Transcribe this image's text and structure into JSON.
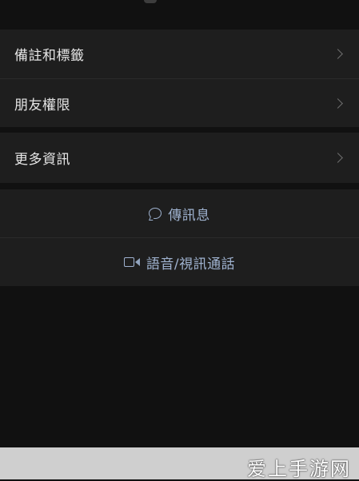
{
  "menu": {
    "items": [
      {
        "label": "備註和標籤"
      },
      {
        "label": "朋友權限"
      },
      {
        "label": "更多資訊"
      }
    ]
  },
  "actions": {
    "message_label": "傳訊息",
    "call_label": "語音/視訊通話"
  },
  "icons": {
    "message": "chat-bubble-icon",
    "call": "video-camera-icon",
    "chevron": "chevron-right-icon"
  },
  "watermark": {
    "text": "爱上手游网"
  },
  "colors": {
    "background": "#111111",
    "surface": "#1e1e1e",
    "text": "#e6e6e6",
    "accent": "#9fb2cf"
  }
}
